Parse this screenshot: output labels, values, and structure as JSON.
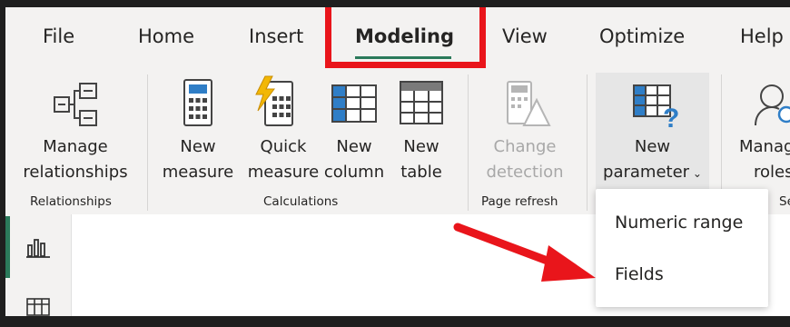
{
  "tabs": [
    {
      "label": "File"
    },
    {
      "label": "Home"
    },
    {
      "label": "Insert"
    },
    {
      "label": "Modeling"
    },
    {
      "label": "View"
    },
    {
      "label": "Optimize"
    },
    {
      "label": "Help"
    }
  ],
  "active_tab": "Modeling",
  "ribbon": {
    "manage_relationships": {
      "line1": "Manage",
      "line2": "relationships"
    },
    "new_measure": {
      "line1": "New",
      "line2": "measure"
    },
    "quick_measure": {
      "line1": "Quick",
      "line2": "measure"
    },
    "new_column": {
      "line1": "New",
      "line2": "column"
    },
    "new_table": {
      "line1": "New",
      "line2": "table"
    },
    "change_detection": {
      "line1": "Change",
      "line2": "detection"
    },
    "new_parameter": {
      "line1": "New",
      "line2": "parameter"
    },
    "manage_roles": {
      "line1": "Manag",
      "line2": "roles"
    }
  },
  "groups": {
    "relationships": "Relationships",
    "calculations": "Calculations",
    "page_refresh": "Page refresh",
    "security": "Se"
  },
  "dropdown": {
    "items": [
      "Numeric range",
      "Fields"
    ]
  },
  "colors": {
    "accent": "#2b7a5b",
    "highlight_red": "#e9151b",
    "icon_blue": "#2f7ec7",
    "icon_yellow": "#f2b705"
  }
}
